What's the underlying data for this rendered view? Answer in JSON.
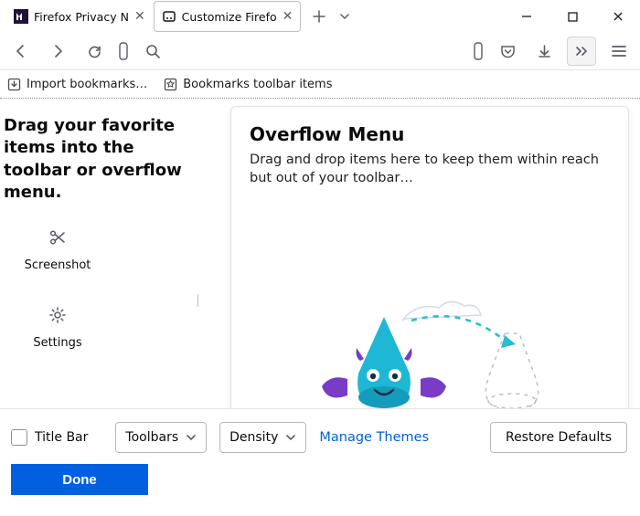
{
  "tabs": [
    {
      "title": "Firefox Privacy N"
    },
    {
      "title": "Customize Firefo"
    }
  ],
  "bookmarks": {
    "import": "Import bookmarks…",
    "toolbar": "Bookmarks toolbar items"
  },
  "left": {
    "heading": "Drag your favorite items into the toolbar or overflow menu.",
    "items": [
      {
        "label": "Screenshot"
      },
      {
        "label": "Settings"
      }
    ]
  },
  "panel": {
    "title": "Overflow Menu",
    "body": "Drag and drop items here to keep them within reach but out of your toolbar…"
  },
  "footer": {
    "title_bar": "Title Bar",
    "toolbars": "Toolbars",
    "density": "Density",
    "manage_themes": "Manage Themes",
    "restore": "Restore Defaults",
    "done": "Done"
  }
}
